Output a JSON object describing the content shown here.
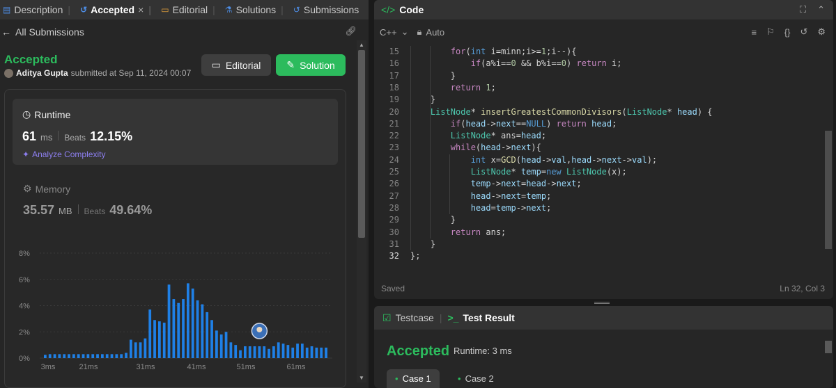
{
  "tabs": [
    {
      "label": "Description",
      "icon": "description-icon"
    },
    {
      "label": "Accepted",
      "icon": "history-icon",
      "close": "×"
    },
    {
      "label": "Editorial",
      "icon": "book-icon"
    },
    {
      "label": "Solutions",
      "icon": "flask-icon"
    },
    {
      "label": "Submissions",
      "icon": "history-icon"
    }
  ],
  "subheader": {
    "back": "←",
    "label": "All Submissions",
    "share_icon": "link-icon"
  },
  "submission": {
    "status": "Accepted",
    "user": "Aditya Gupta",
    "submitted_text": "submitted at Sep 11, 2024 00:07",
    "editorial_button": "Editorial",
    "solution_button": "Solution"
  },
  "runtime": {
    "title": "Runtime",
    "value": "61",
    "unit": "ms",
    "beats_label": "Beats",
    "beats": "12.15%",
    "analyze": "Analyze Complexity"
  },
  "memory": {
    "title": "Memory",
    "value": "35.57",
    "unit": "MB",
    "beats_label": "Beats",
    "beats": "49.64%"
  },
  "chart_data": {
    "type": "bar",
    "ylim": [
      0,
      8
    ],
    "yticks": [
      "8%",
      "6%",
      "4%",
      "2%",
      "0%"
    ],
    "xticks": [
      "3ms",
      "21ms",
      "31ms",
      "41ms",
      "51ms",
      "61ms"
    ],
    "values": [
      0.25,
      0.3,
      0.3,
      0.3,
      0.3,
      0.3,
      0.3,
      0.3,
      0.3,
      0.3,
      0.3,
      0.3,
      0.3,
      0.3,
      0.3,
      0.3,
      0.3,
      0.4,
      1.4,
      1.2,
      1.2,
      1.5,
      3.7,
      2.9,
      2.8,
      2.7,
      5.6,
      4.5,
      4.2,
      4.5,
      5.7,
      5.3,
      4.4,
      4.1,
      3.5,
      2.9,
      2.1,
      1.8,
      2.0,
      1.2,
      1.0,
      0.6,
      0.9,
      0.9,
      0.9,
      0.9,
      0.9,
      0.7,
      0.9,
      1.2,
      1.1,
      1.0,
      0.8,
      1.1,
      1.1,
      0.8,
      0.9,
      0.8,
      0.8,
      0.8
    ],
    "highlight_index": 45
  },
  "code": {
    "title": "Code",
    "language": "C++",
    "auto": "Auto",
    "saved": "Saved",
    "cursor": "Ln 32, Col 3",
    "lines": [
      {
        "n": "15",
        "t": "        for(int i=minn;i>=1;i--){"
      },
      {
        "n": "16",
        "t": "            if(a%i==0 && b%i==0) return i;"
      },
      {
        "n": "17",
        "t": "        }"
      },
      {
        "n": "18",
        "t": "        return 1;"
      },
      {
        "n": "19",
        "t": "    }"
      },
      {
        "n": "20",
        "t": "    ListNode* insertGreatestCommonDivisors(ListNode* head) {"
      },
      {
        "n": "21",
        "t": "        if(head->next==NULL) return head;"
      },
      {
        "n": "22",
        "t": "        ListNode* ans=head;"
      },
      {
        "n": "23",
        "t": "        while(head->next){"
      },
      {
        "n": "24",
        "t": "            int x=GCD(head->val,head->next->val);"
      },
      {
        "n": "25",
        "t": "            ListNode* temp=new ListNode(x);"
      },
      {
        "n": "26",
        "t": "            temp->next=head->next;"
      },
      {
        "n": "27",
        "t": "            head->next=temp;"
      },
      {
        "n": "28",
        "t": "            head=temp->next;"
      },
      {
        "n": "29",
        "t": "        }"
      },
      {
        "n": "30",
        "t": "        return ans;"
      },
      {
        "n": "31",
        "t": "    }"
      },
      {
        "n": "32",
        "t": "};"
      }
    ]
  },
  "result": {
    "testcase_tab": "Testcase",
    "result_tab": "Test Result",
    "status": "Accepted",
    "runtime": "Runtime: 3 ms",
    "cases": [
      "Case 1",
      "Case 2"
    ]
  },
  "colors": {
    "accent_green": "#2cbb5d",
    "bar": "#1a7de0",
    "purple": "#8d7ff0"
  }
}
